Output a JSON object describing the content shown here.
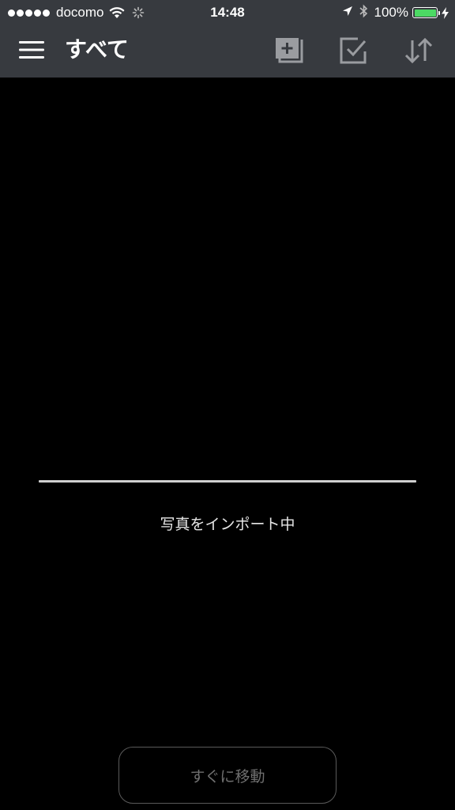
{
  "status_bar": {
    "carrier": "docomo",
    "time": "14:48",
    "battery_percent": "100%",
    "battery_level": 1.0,
    "battery_color": "#4cd964",
    "icons": [
      "signal-dots-icon",
      "wifi-icon",
      "activity-spinner-icon",
      "location-arrow-icon",
      "bluetooth-icon",
      "battery-icon",
      "charging-bolt-icon"
    ]
  },
  "nav": {
    "title": "すべて",
    "menu_icon": "hamburger-menu-icon",
    "actions": [
      {
        "name": "add-album",
        "icon": "add-album-icon"
      },
      {
        "name": "select",
        "icon": "checkbox-select-icon"
      },
      {
        "name": "sort",
        "icon": "sort-arrows-icon"
      }
    ],
    "background": "#373a3f"
  },
  "import": {
    "progress": 1.0,
    "status_text": "写真をインポート中"
  },
  "move_button": {
    "label": "すぐに移動"
  }
}
